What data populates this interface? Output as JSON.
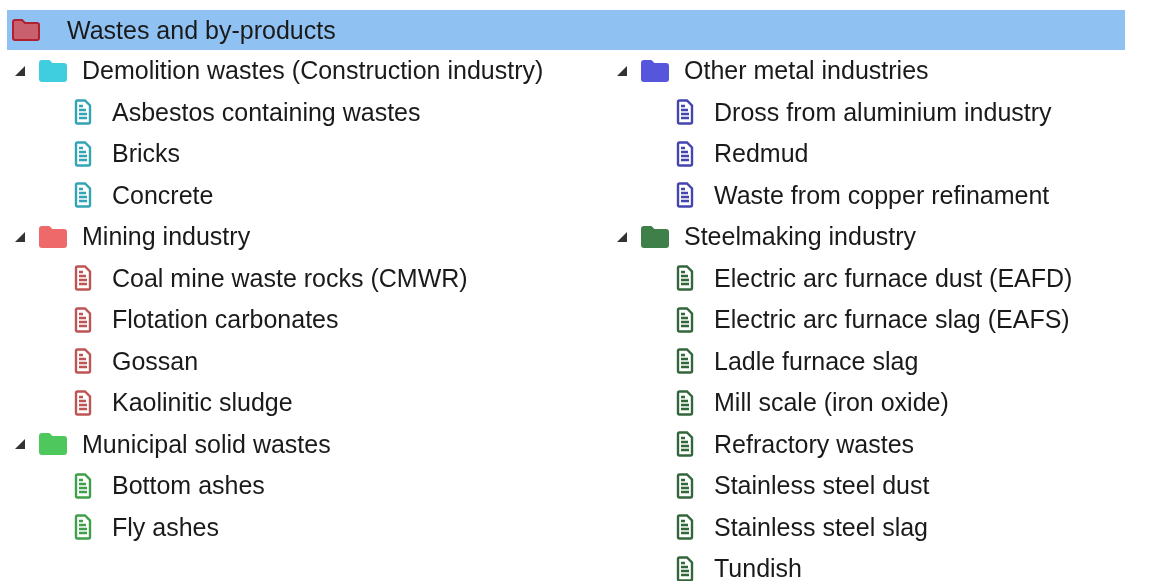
{
  "tree": {
    "root": {
      "label": "Wastes and by-products",
      "color": "#c9606e",
      "selected": true
    },
    "columns": [
      [
        {
          "label": "Demolition wastes (Construction industry)",
          "color": "#3fcde0",
          "expanded": true,
          "selected": false,
          "children": [
            {
              "label": "Asbestos containing wastes",
              "selected": false
            },
            {
              "label": "Bricks",
              "selected": false
            },
            {
              "label": "Concrete",
              "selected": false
            }
          ]
        },
        {
          "label": "Mining industry",
          "color": "#ee6a6a",
          "expanded": true,
          "selected": false,
          "children": [
            {
              "label": "Coal mine waste rocks (CMWR)",
              "selected": false
            },
            {
              "label": "Flotation carbonates",
              "selected": false
            },
            {
              "label": "Gossan",
              "selected": false
            },
            {
              "label": "Kaolinitic sludge",
              "selected": false
            }
          ]
        },
        {
          "label": "Municipal solid wastes",
          "color": "#4ec85c",
          "expanded": true,
          "selected": false,
          "children": [
            {
              "label": "Bottom ashes",
              "selected": false
            },
            {
              "label": "Fly ashes",
              "selected": false
            }
          ]
        }
      ],
      [
        {
          "label": "Other metal industries",
          "color": "#5656dc",
          "expanded": true,
          "selected": false,
          "children": [
            {
              "label": "Dross from aluminium industry",
              "selected": false
            },
            {
              "label": "Redmud",
              "selected": false
            },
            {
              "label": "Waste from copper refinament",
              "selected": false
            }
          ]
        },
        {
          "label": "Steelmaking industry",
          "color": "#3f7f4a",
          "expanded": true,
          "selected": false,
          "children": [
            {
              "label": "Electric arc furnace dust (EAFD)",
              "selected": false
            },
            {
              "label": "Electric arc furnace slag (EAFS)",
              "selected": false
            },
            {
              "label": "Ladle furnace slag",
              "selected": false
            },
            {
              "label": "Mill scale (iron oxide)",
              "selected": false
            },
            {
              "label": "Refractory wastes",
              "selected": false
            },
            {
              "label": "Stainless steel dust",
              "selected": false
            },
            {
              "label": "Stainless steel slag",
              "selected": false
            },
            {
              "label": "Tundish",
              "selected": false
            }
          ]
        }
      ]
    ]
  }
}
